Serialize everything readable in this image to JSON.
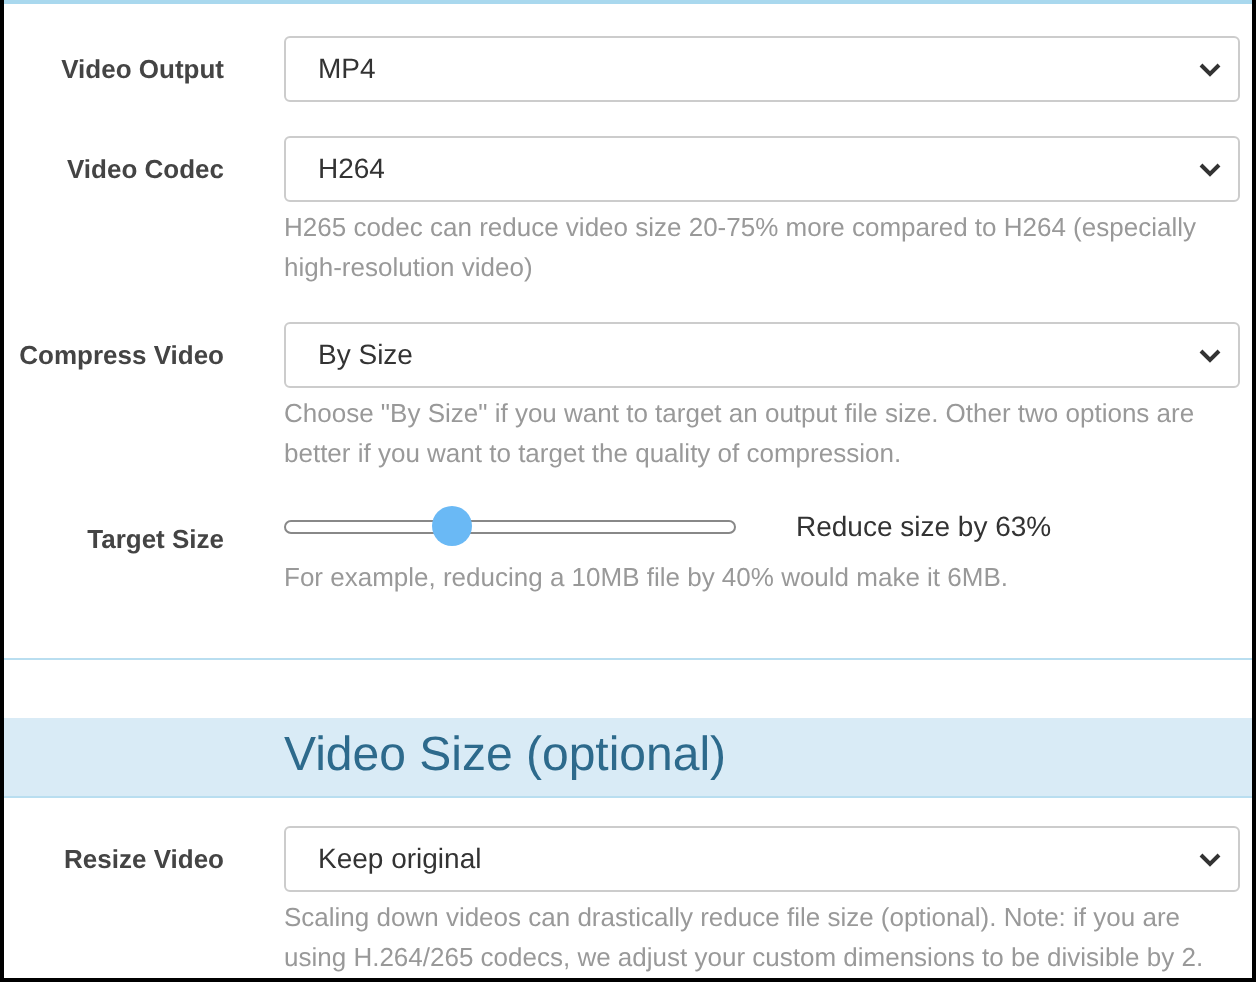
{
  "settings": [
    {
      "kind": "select",
      "label": "Video Output",
      "value": "MP4"
    },
    {
      "kind": "select",
      "label": "Video Codec",
      "value": "H264",
      "help": "H265 codec can reduce video size 20-75% more compared to H264 (especially high-resolution video)"
    },
    {
      "kind": "select",
      "label": "Compress Video",
      "value": "By Size",
      "help": "Choose \"By Size\" if you want to target an output file size. Other two options are better if you want to target the quality of compression."
    },
    {
      "kind": "slider",
      "label": "Target Size",
      "level": 0.37,
      "reading": "Reduce size by 63%",
      "help": "For example, reducing a 10MB file by 40% would make it 6MB."
    }
  ],
  "section": {
    "title": "Video Size (optional)",
    "settings": [
      {
        "kind": "select",
        "label": "Resize Video",
        "value": "Keep original",
        "help": "Scaling down videos can drastically reduce file size (optional). Note: if you are using H.264/265 codecs, we adjust your custom dimensions to be divisible by 2."
      }
    ]
  }
}
